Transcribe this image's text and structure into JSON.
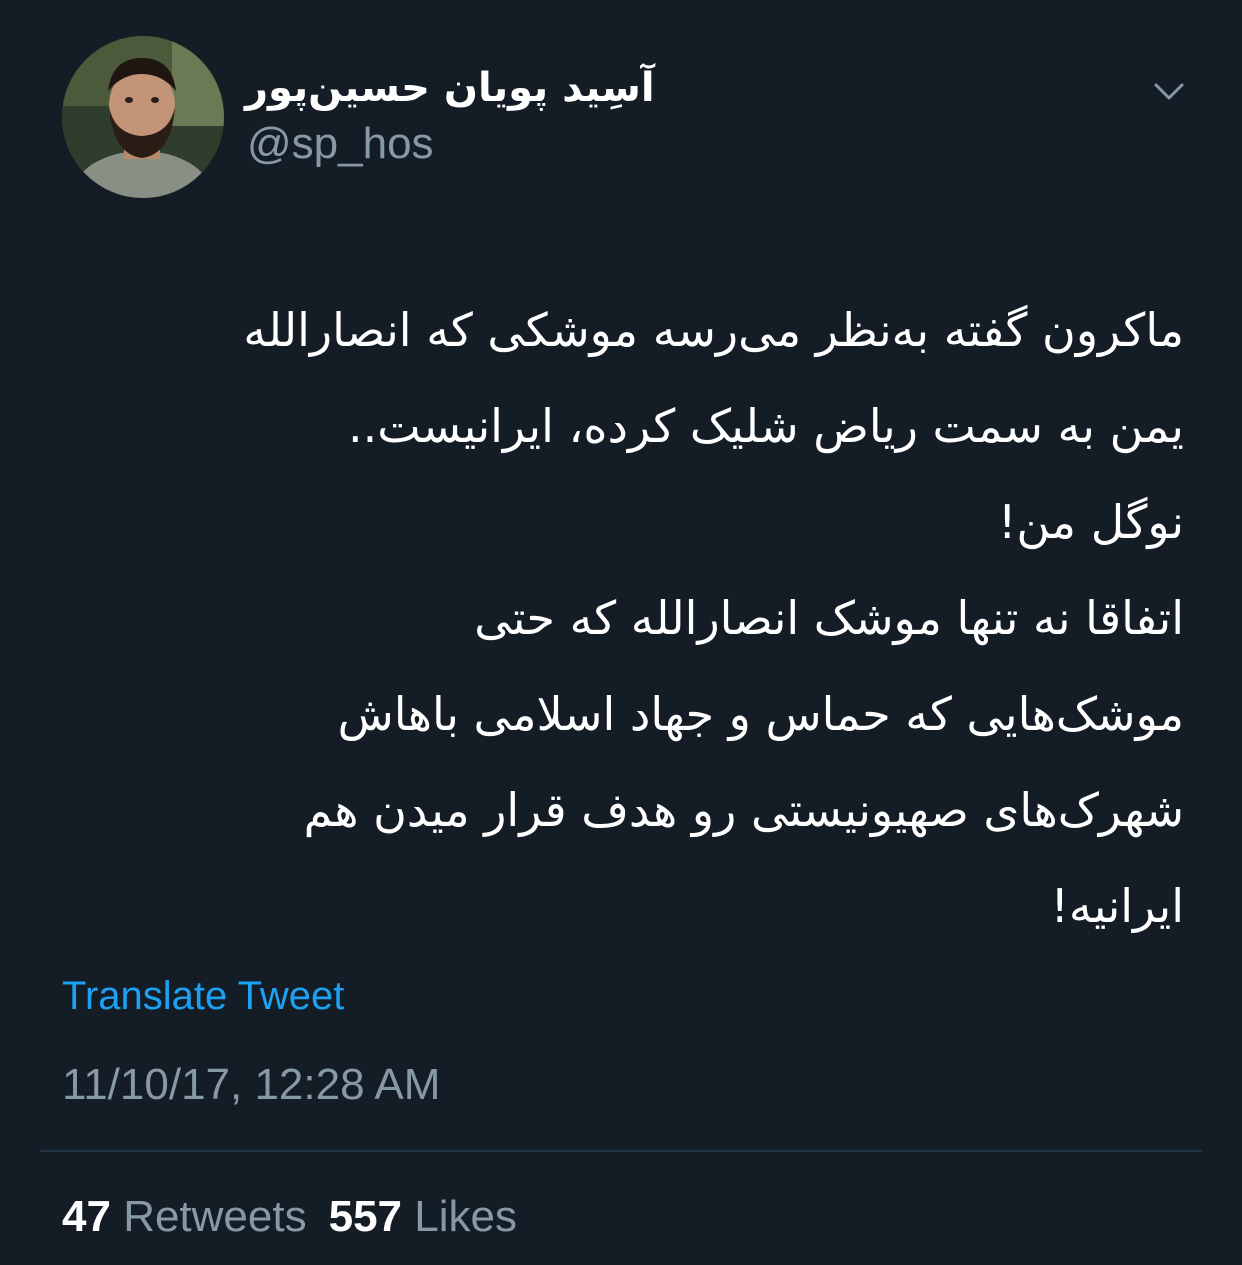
{
  "user": {
    "display_name": "آسِید پویان حسین‌پور",
    "handle": "@sp_hos",
    "avatar_icon": "profile-photo"
  },
  "menu": {
    "icon": "chevron-down-icon"
  },
  "tweet": {
    "lines": [
      "ماکرون گفته به‌نظر می‌رسه موشکی که انصارالله",
      "یمن به سمت ریاض شلیک کرده، ایرانیست..",
      "نوگل من!",
      "اتفاقا نه تنها موشک انصارالله که حتی",
      "موشک‌هایی که حماس و جهاد اسلامی باهاش",
      "شهرک‌های صهیونیستی رو هدف قرار میدن هم",
      "ایرانیه!"
    ],
    "translate_label": "Translate Tweet",
    "timestamp": "11/10/17, 12:28 AM"
  },
  "stats": {
    "retweets_count": "47",
    "retweets_label": "Retweets",
    "likes_count": "557",
    "likes_label": "Likes"
  },
  "colors": {
    "background": "#141d26",
    "text": "#ffffff",
    "secondary": "#8899a6",
    "link": "#1da1f2",
    "divider": "#243447"
  }
}
